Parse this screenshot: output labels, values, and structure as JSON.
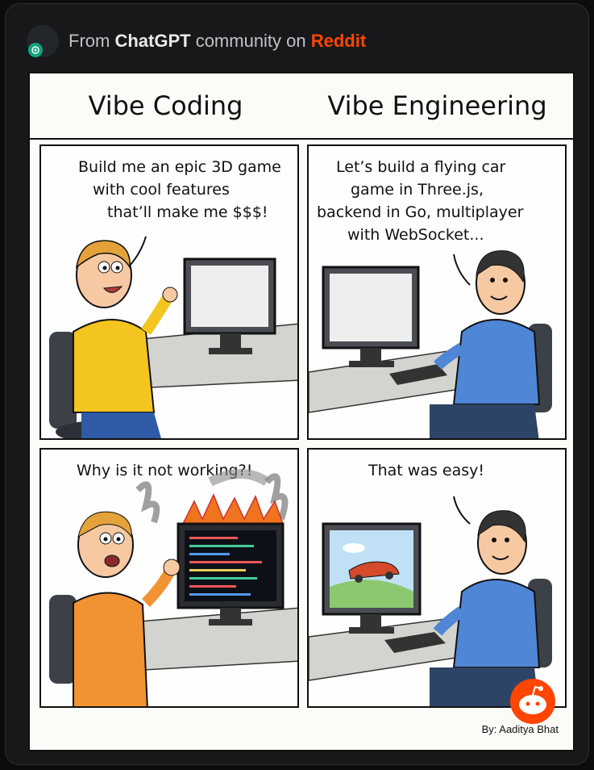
{
  "header": {
    "prefix": "From ",
    "brand": "ChatGPT",
    "middle": " community on ",
    "platform": "Reddit",
    "avatar_icon": "openai-logo-icon"
  },
  "comic": {
    "titles": [
      "Vibe Coding",
      "Vibe Engineering"
    ],
    "panels": [
      {
        "caption_lines": [
          "Build me an epic 3D game",
          "with cool features",
          "that’ll make me $$$!"
        ]
      },
      {
        "caption_lines": [
          "Let’s build a flying car",
          "game in Three.js,",
          "backend in Go, multiplayer",
          "with WebSocket..."
        ]
      },
      {
        "caption_lines": [
          "Why is it not working?!"
        ]
      },
      {
        "caption_lines": [
          "That was easy!"
        ]
      }
    ],
    "credit": "By: Aaditya Bhat"
  },
  "colors": {
    "reddit": "#ff4500",
    "openai": "#10a37f",
    "shirt_yellow": "#f5c51f",
    "shirt_orange": "#f29333",
    "shirt_blue": "#4f86d6"
  }
}
